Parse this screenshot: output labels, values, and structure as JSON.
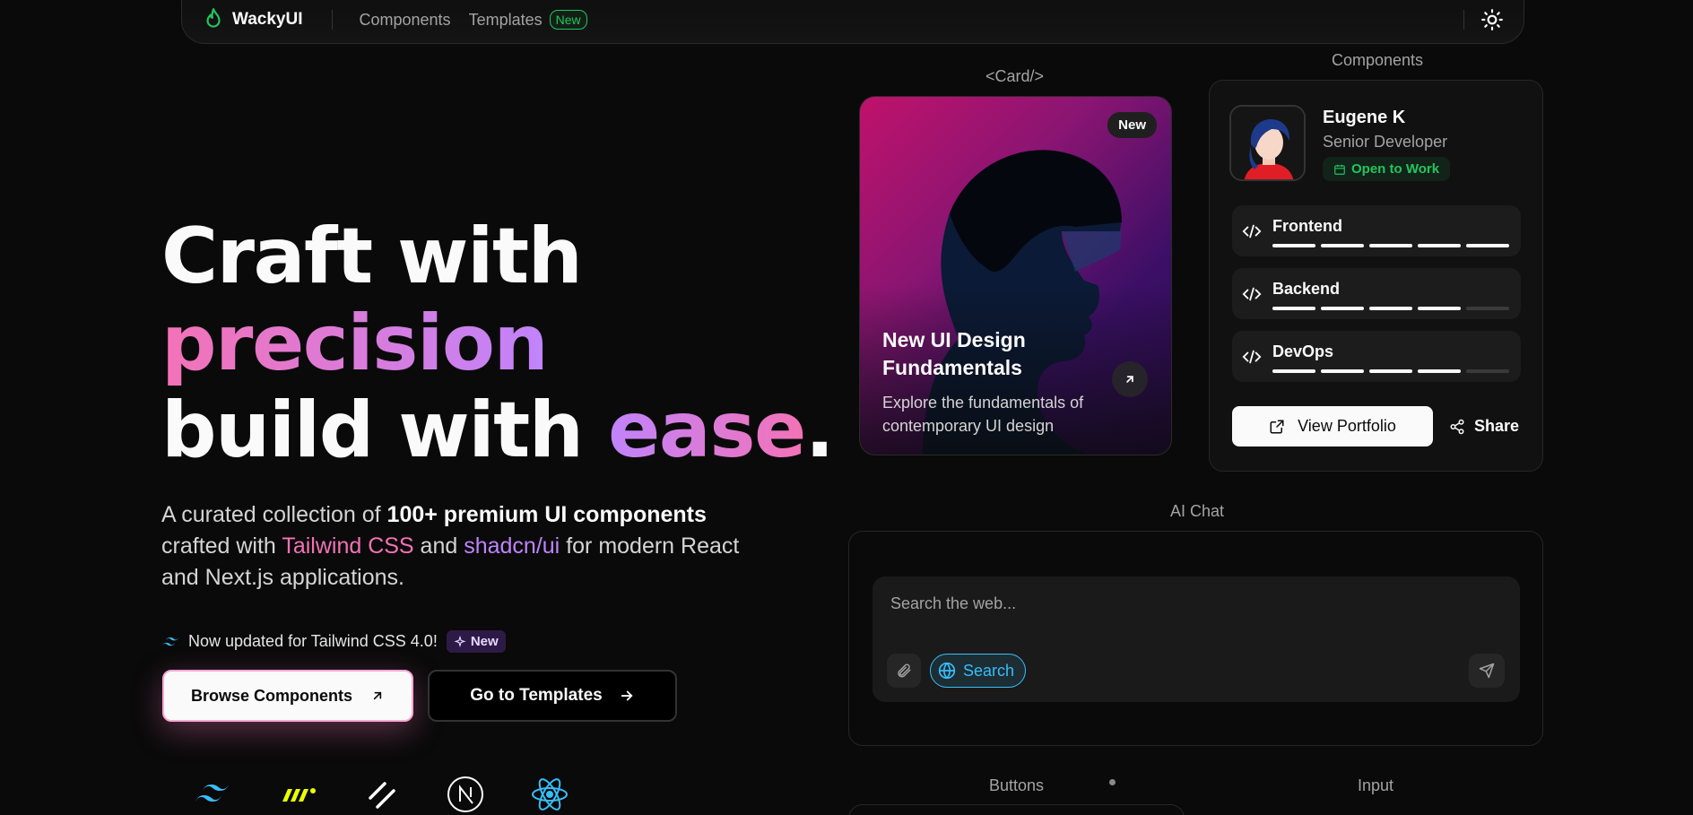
{
  "nav": {
    "brand": "WackyUI",
    "links": [
      "Components",
      "Templates"
    ],
    "templates_badge": "New",
    "theme_icon": "sun-icon",
    "brand_color": "#22c55e"
  },
  "hero": {
    "line1": "Craft with",
    "line2": "precision",
    "line3a": "build with ",
    "line3b": "ease",
    "line3c": ".",
    "desc_1": "A curated collection of ",
    "desc_bold": "100+ premium UI components",
    "desc_2": " crafted with ",
    "desc_tw": "Tailwind CSS",
    "desc_3": " and ",
    "desc_shad": "shadcn/ui",
    "desc_4": " for modern React and Next.js applications.",
    "update_text": "Now updated for Tailwind CSS 4.0!",
    "update_badge": "New",
    "browse_label": "Browse Components",
    "templates_label": "Go to Templates",
    "tech_icons": [
      "tailwind-icon",
      "motion-icon",
      "shadcn-icon",
      "nextjs-icon",
      "react-icon"
    ]
  },
  "sections": {
    "card_label": "<Card/>",
    "components_label": "Components",
    "ai_chat_label": "AI Chat",
    "buttons_label": "Buttons",
    "input_label": "Input"
  },
  "image_card": {
    "badge": "New",
    "title": "New UI Design Fundamentals",
    "subtitle": "Explore the fundamentals of contemporary UI design"
  },
  "profile": {
    "name": "Eugene K",
    "role": "Senior Developer",
    "status": "Open to Work",
    "skills": [
      {
        "name": "Frontend",
        "level": 5,
        "max": 5
      },
      {
        "name": "Backend",
        "level": 4,
        "max": 5
      },
      {
        "name": "DevOps",
        "level": 4,
        "max": 5
      }
    ],
    "portfolio_label": "View Portfolio",
    "share_label": "Share"
  },
  "chat": {
    "placeholder": "Search the web...",
    "search_label": "Search"
  }
}
